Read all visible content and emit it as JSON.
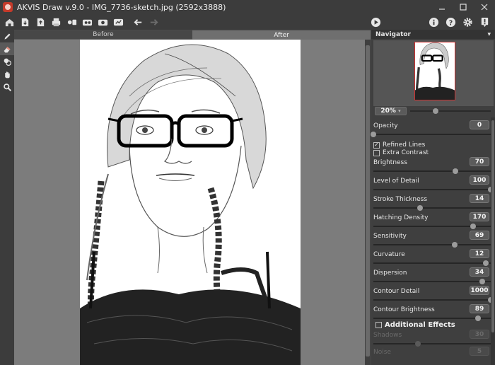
{
  "window": {
    "title": "AKVIS Draw v.9.0 - IMG_7736-sketch.jpg (2592x3888)",
    "minimize_icon": "minimize-icon",
    "maximize_icon": "maximize-icon",
    "close_icon": "close-icon"
  },
  "toolbar": {
    "left_icons": [
      "home-icon",
      "open-file-icon",
      "save-file-icon",
      "print-icon",
      "batch-icon",
      "presets-icon",
      "settings-icon",
      "share-icon",
      "undo-icon",
      "redo-icon"
    ],
    "run_icon": "play-icon",
    "right_icons": [
      "info-icon",
      "help-icon",
      "gear-icon",
      "notification-icon"
    ]
  },
  "tools": [
    {
      "name": "pencil-tool-icon",
      "active": false
    },
    {
      "name": "eraser-tool-icon",
      "active": true
    },
    {
      "name": "stamp-tool-icon",
      "active": false
    },
    {
      "name": "hand-tool-icon",
      "active": false
    },
    {
      "name": "zoom-tool-icon",
      "active": false
    }
  ],
  "tabs": {
    "before": "Before",
    "after": "After"
  },
  "navigator": {
    "title": "Navigator",
    "zoom": "20%",
    "zoom_slider": 0.28
  },
  "params": {
    "opacity": {
      "label": "Opacity",
      "value": "0",
      "pos": 0.0
    },
    "refined_lines": {
      "label": "Refined Lines",
      "checked": true
    },
    "extra_contrast": {
      "label": "Extra Contrast",
      "checked": false
    },
    "brightness": {
      "label": "Brightness",
      "value": "70",
      "pos": 0.7
    },
    "level_of_detail": {
      "label": "Level of Detail",
      "value": "100",
      "pos": 1.0
    },
    "stroke_thickness": {
      "label": "Stroke Thickness",
      "value": "14",
      "pos": 0.4
    },
    "hatching_density": {
      "label": "Hatching Density",
      "value": "170",
      "pos": 0.85
    },
    "sensitivity": {
      "label": "Sensitivity",
      "value": "69",
      "pos": 0.69
    },
    "curvature": {
      "label": "Curvature",
      "value": "12",
      "pos": 0.96
    },
    "dispersion": {
      "label": "Dispersion",
      "value": "34",
      "pos": 0.93
    },
    "contour_detail": {
      "label": "Contour Detail",
      "value": "1000",
      "pos": 1.0
    },
    "contour_brightness": {
      "label": "Contour Brightness",
      "value": "89",
      "pos": 0.89
    }
  },
  "additional_effects": {
    "label": "Additional Effects",
    "checked": false,
    "shadows_label": "Shadows",
    "shadows_value": "30",
    "noise_label": "Noise",
    "noise_value": "5"
  }
}
